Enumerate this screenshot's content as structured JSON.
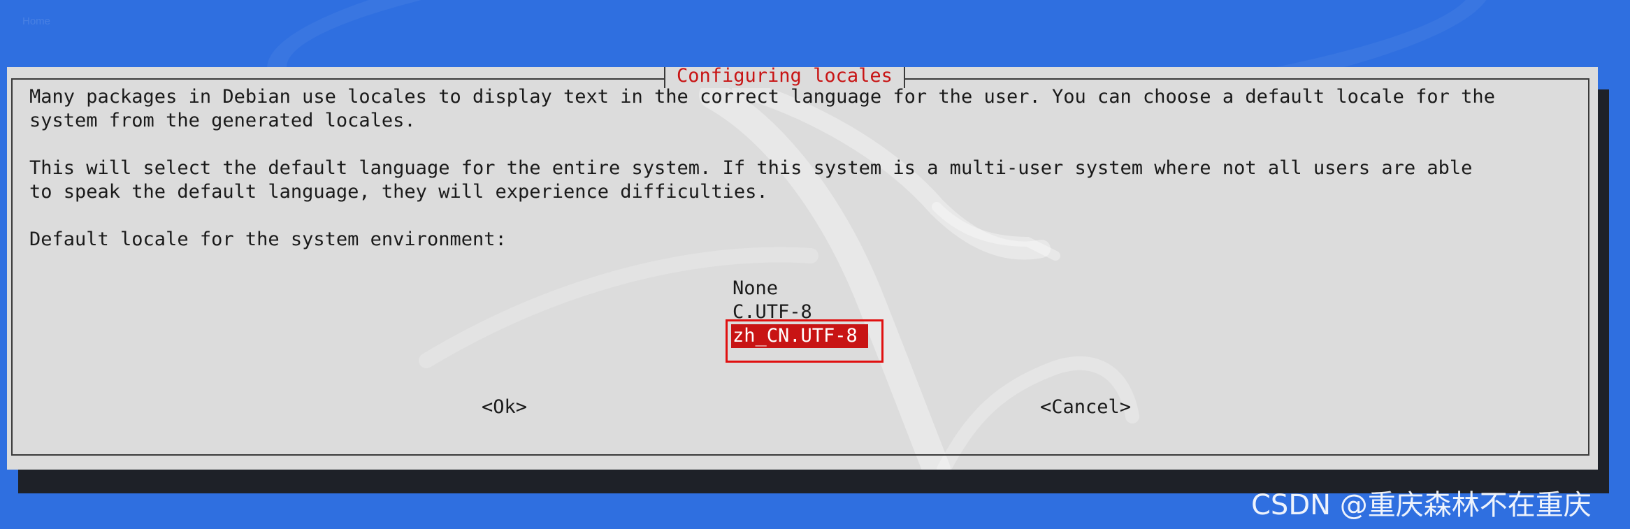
{
  "desktop": {
    "top_label": "Home"
  },
  "dialog": {
    "title": "Configuring locales",
    "paragraph_1_line_1": "Many packages in Debian use locales to display text in the correct language for the user. You can choose a default locale for the",
    "paragraph_1_line_2": "system from the generated locales.",
    "paragraph_2_line_1": "This will select the default language for the entire system. If this system is a multi-user system where not all users are able",
    "paragraph_2_line_2": "to speak the default language, they will experience difficulties.",
    "prompt": "Default locale for the system environment:",
    "options": [
      "None",
      "C.UTF-8",
      "zh_CN.UTF-8"
    ],
    "selected_option": "zh_CN.UTF-8",
    "ok_label": "<Ok>",
    "cancel_label": "<Cancel>"
  },
  "watermark": "CSDN @重庆森林不在重庆",
  "colors": {
    "desktop_blue": "#2f6fe0",
    "dialog_gray": "#dcdcdc",
    "accent_red": "#c81414",
    "annotation_red": "#e01010"
  }
}
